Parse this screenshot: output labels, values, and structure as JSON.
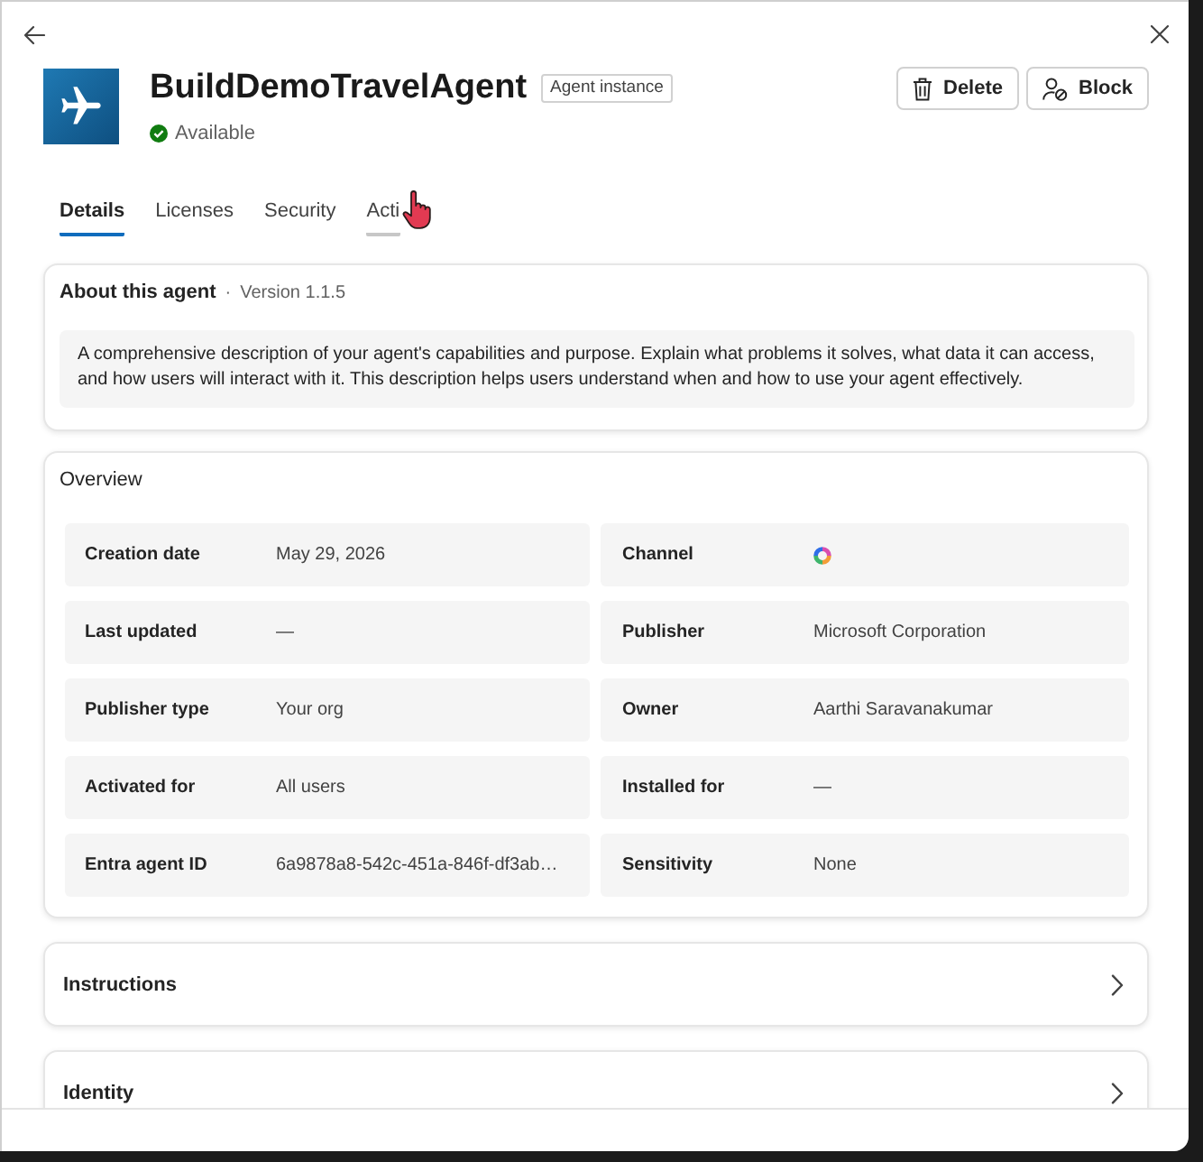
{
  "agent": {
    "name": "BuildDemoTravelAgent",
    "badge": "Agent instance",
    "status": "Available",
    "actions": [
      {
        "kind": "delete",
        "label": "Delete"
      },
      {
        "kind": "block",
        "label": "Block"
      }
    ]
  },
  "tabs": [
    {
      "label": "Details",
      "selected": true,
      "hovered": false
    },
    {
      "label": "Licenses",
      "selected": false,
      "hovered": false
    },
    {
      "label": "Security",
      "selected": false,
      "hovered": false
    },
    {
      "label": "Acti",
      "selected": false,
      "hovered": true
    }
  ],
  "about": {
    "title": "About this agent",
    "separator": "·",
    "version": "Version 1.1.5",
    "description": "A comprehensive description of your agent's capabilities and purpose. Explain what problems it solves, what data it can access, and how users will interact with it. This description helps users understand when and how to use your agent effectively."
  },
  "overview": {
    "title": "Overview",
    "fields": [
      {
        "kind": "text",
        "label": "Creation date",
        "value": "May 29, 2026"
      },
      {
        "kind": "icon",
        "label": "Channel"
      },
      {
        "kind": "text",
        "label": "Last updated",
        "value": "—"
      },
      {
        "kind": "text",
        "label": "Publisher",
        "value": "Microsoft Corporation"
      },
      {
        "kind": "text",
        "label": "Publisher type",
        "value": "Your org"
      },
      {
        "kind": "text",
        "label": "Owner",
        "value": "Aarthi Saravanakumar"
      },
      {
        "kind": "text",
        "label": "Activated for",
        "value": "All users"
      },
      {
        "kind": "text",
        "label": "Installed for",
        "value": "—"
      },
      {
        "kind": "text",
        "label": "Entra agent ID",
        "value": "6a9878a8-542c-451a-846f-df3ab…"
      },
      {
        "kind": "text",
        "label": "Sensitivity",
        "value": "None"
      }
    ]
  },
  "sections": [
    {
      "title": "Instructions",
      "expanded": false
    },
    {
      "title": "Identity",
      "expanded": false
    }
  ]
}
